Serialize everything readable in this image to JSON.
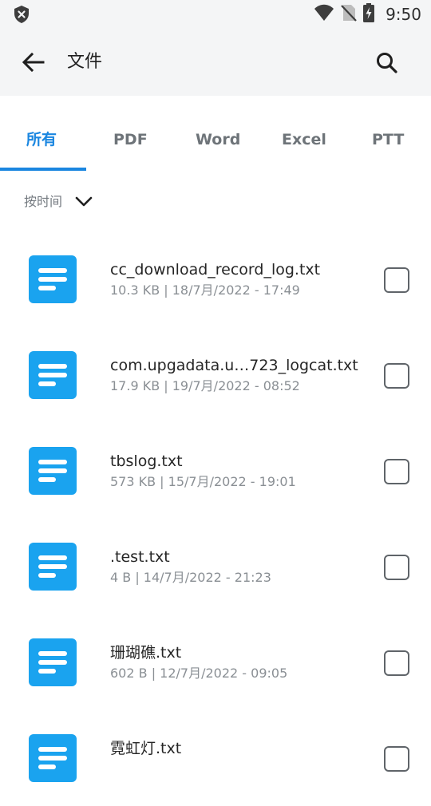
{
  "status_bar": {
    "time": "9:50",
    "icons": [
      "shield-icon",
      "wifi-icon",
      "no-sim-icon",
      "battery-charging-icon"
    ]
  },
  "app_bar": {
    "title": "文件",
    "back_icon": "arrow-left-icon",
    "search_icon": "search-icon"
  },
  "tabs": [
    {
      "label": "所有",
      "active": true
    },
    {
      "label": "PDF",
      "active": false
    },
    {
      "label": "Word",
      "active": false
    },
    {
      "label": "Excel",
      "active": false
    },
    {
      "label": "PTT",
      "active": false
    }
  ],
  "sort": {
    "label": "按时间",
    "icon": "chevron-down-icon"
  },
  "files": [
    {
      "name": "cc_download_record_log.txt",
      "meta": "10.3 KB  |  18/7月/2022 - 17:49",
      "checked": false
    },
    {
      "name": "com.upgadata.u…723_logcat.txt",
      "meta": "17.9 KB  |  19/7月/2022 - 08:52",
      "checked": false
    },
    {
      "name": "tbslog.txt",
      "meta": "573 KB  |  15/7月/2022 - 19:01",
      "checked": false
    },
    {
      "name": ".test.txt",
      "meta": "4 B  |  14/7月/2022 - 21:23",
      "checked": false
    },
    {
      "name": "珊瑚礁.txt",
      "meta": "602 B  |  12/7月/2022 - 09:05",
      "checked": false
    },
    {
      "name": "霓虹灯.txt",
      "meta": "",
      "checked": false
    }
  ],
  "colors": {
    "accent": "#1a86e0",
    "file_icon": "#1aa3ef",
    "header_bg": "#f4f5f6"
  }
}
